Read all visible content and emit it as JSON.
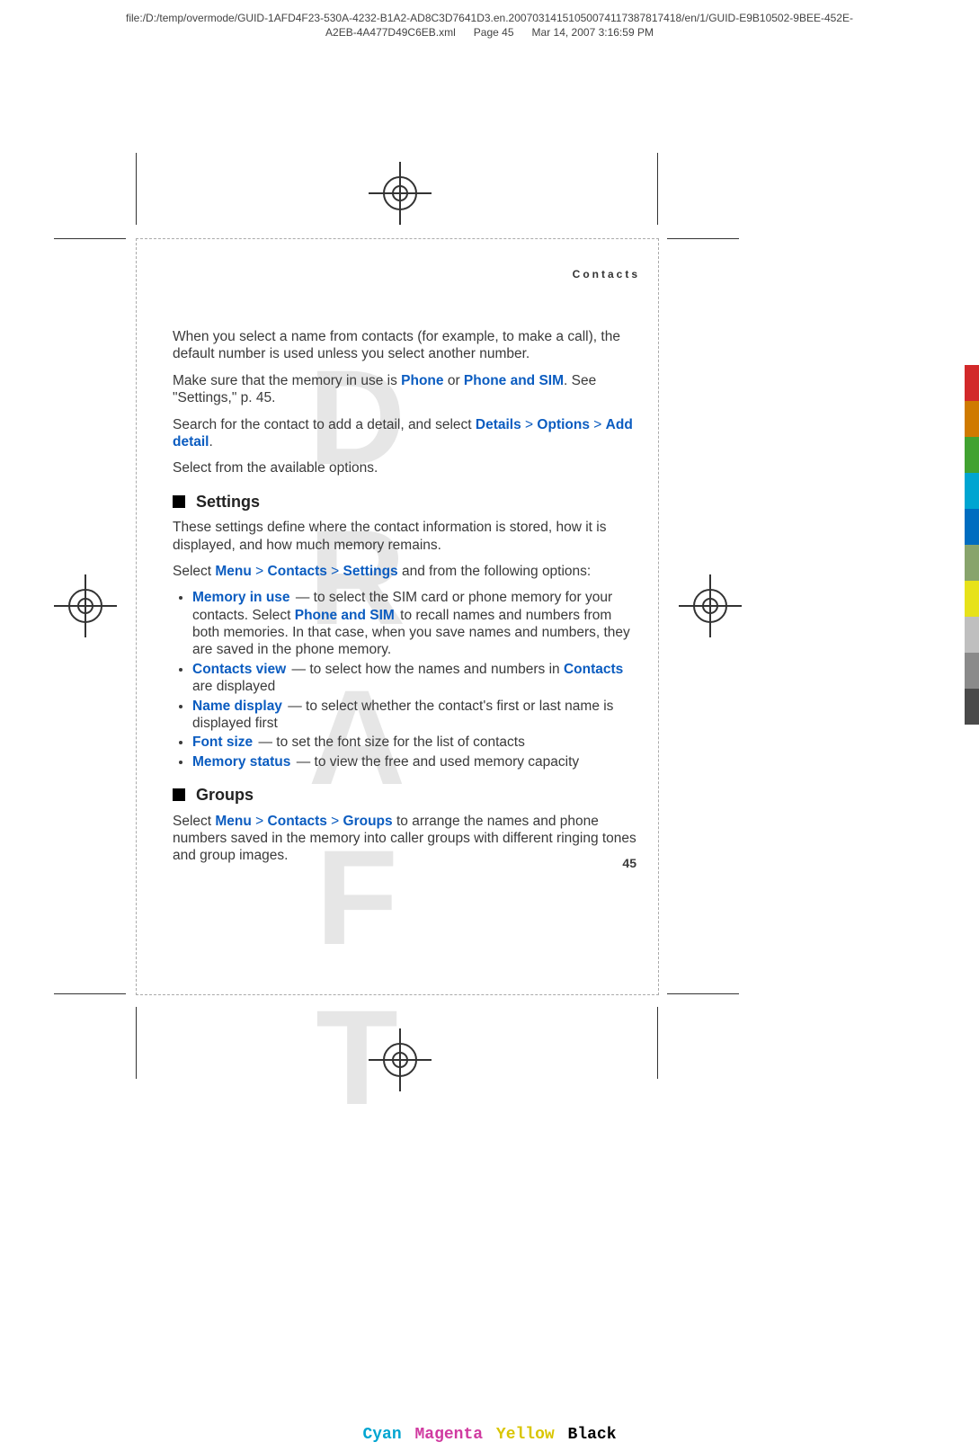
{
  "header": {
    "line1": "file:/D:/temp/overmode/GUID-1AFD4F23-530A-4232-B1A2-AD8C3D7641D3.en.20070314151050074117387817418/en/1/GUID-E9B10502-9BEE-452E-",
    "line2": "A2EB-4A477D49C6EB.xml",
    "page": "Page 45",
    "date": "Mar 14, 2007 3:16:59 PM"
  },
  "chapter": "Contacts",
  "watermark": "DRAFT",
  "intro": {
    "p1": "When you select a name from contacts (for example, to make a call), the default number is used unless you select another number.",
    "p2_a": "Make sure that the memory in use is ",
    "p2_l1": "Phone",
    "p2_b": " or ",
    "p2_l2": "Phone and SIM",
    "p2_c": ". See \"Settings,\" p. 45.",
    "p3_a": "Search for the contact to add a detail, and select ",
    "p3_l1": "Details",
    "gt": " > ",
    "p3_l2": "Options",
    "p3_l3": "Add detail",
    "p3_b": ".",
    "p4": "Select from the available options."
  },
  "settings": {
    "title": "Settings",
    "p1": "These settings define where the contact information is stored, how it is displayed, and how much memory remains.",
    "p2_a": "Select ",
    "p2_l1": "Menu",
    "p2_l2": "Contacts",
    "p2_l3": "Settings",
    "p2_b": " and from the following options:",
    "items": [
      {
        "k": "Memory in use",
        "t_a": "  — to select the SIM card or phone memory for your contacts. Select ",
        "t_link": "Phone and SIM",
        "t_b": " to recall names and numbers from both memories. In that case, when you save names and numbers, they are saved in the phone memory."
      },
      {
        "k": "Contacts view",
        "t_a": "  — to select how the names and numbers in ",
        "t_link": "Contacts",
        "t_b": " are displayed"
      },
      {
        "k": "Name display",
        "t_a": " —  to select whether the contact's first or last name is displayed first",
        "t_link": "",
        "t_b": ""
      },
      {
        "k": "Font size",
        "t_a": "  — to set the font size for the list of contacts",
        "t_link": "",
        "t_b": ""
      },
      {
        "k": "Memory status",
        "t_a": " —  to view the free and used memory capacity",
        "t_link": "",
        "t_b": ""
      }
    ]
  },
  "groups": {
    "title": "Groups",
    "p_a": "Select ",
    "p_l1": "Menu",
    "p_l2": "Contacts",
    "p_l3": "Groups",
    "p_b": " to arrange the names and phone numbers saved in the memory into caller groups with different ringing tones and group images."
  },
  "page_number": "45",
  "cmyk": {
    "c": "Cyan",
    "m": "Magenta",
    "y": "Yellow",
    "k": "Black"
  },
  "swatches": [
    "#d2292a",
    "#cf7a00",
    "#41a231",
    "#00a5d1",
    "#006dc0",
    "#88a46c",
    "#e7e21a",
    "#bfbfbf",
    "#8a8a8a",
    "#4a4a4a"
  ]
}
